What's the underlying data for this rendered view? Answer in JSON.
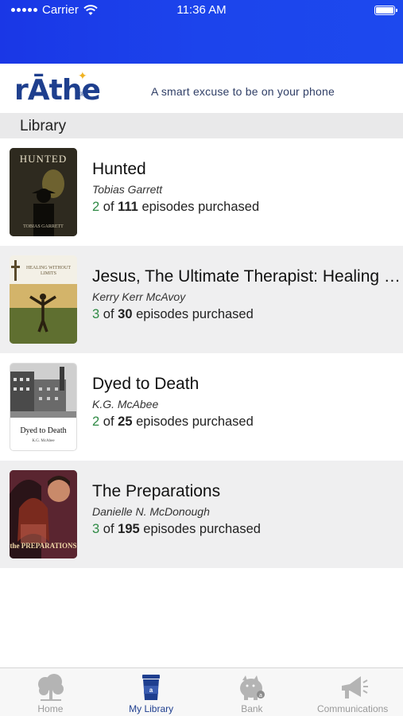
{
  "status_bar": {
    "carrier": "Carrier",
    "time": "11:36 AM"
  },
  "brand": {
    "logo": "rĀthe",
    "tagline": "A smart excuse to be on your phone"
  },
  "section": {
    "title": "Library"
  },
  "books": [
    {
      "title": "Hunted",
      "author": "Tobias Garrett",
      "owned": "2",
      "of": "of",
      "total": "111",
      "suffix": "episodes purchased",
      "cover_title": "HUNTED",
      "cover_author": "TOBIAS GARRETT"
    },
    {
      "title": "Jesus, The Ultimate Therapist: Healing Without Limits",
      "author": "Kerry Kerr McAvoy",
      "owned": "3",
      "of": "of",
      "total": "30",
      "suffix": "episodes purchased",
      "cover_title": "HEALING WITHOUT LIMITS"
    },
    {
      "title": "Dyed to Death",
      "author": "K.G. McAbee",
      "owned": "2",
      "of": "of",
      "total": "25",
      "suffix": "episodes purchased",
      "cover_title": "Dyed to Death",
      "cover_author": "K.G. McAbee"
    },
    {
      "title": "The Preparations",
      "author": "Danielle N. McDonough",
      "owned": "3",
      "of": "of",
      "total": "195",
      "suffix": "episodes purchased",
      "cover_title": "the PREPARATIONS"
    }
  ],
  "tabs": [
    {
      "label": "Home",
      "icon": "tree-icon"
    },
    {
      "label": "My Library",
      "icon": "cup-icon"
    },
    {
      "label": "Bank",
      "icon": "piggy-bank-icon"
    },
    {
      "label": "Communications",
      "icon": "megaphone-icon"
    }
  ],
  "colors": {
    "header_blue": "#1c44ec",
    "brand_navy": "#1e3f8e",
    "owned_green": "#2f8a45",
    "active_tab": "#1f3f8f",
    "inactive_tab": "#9a9a9a"
  }
}
